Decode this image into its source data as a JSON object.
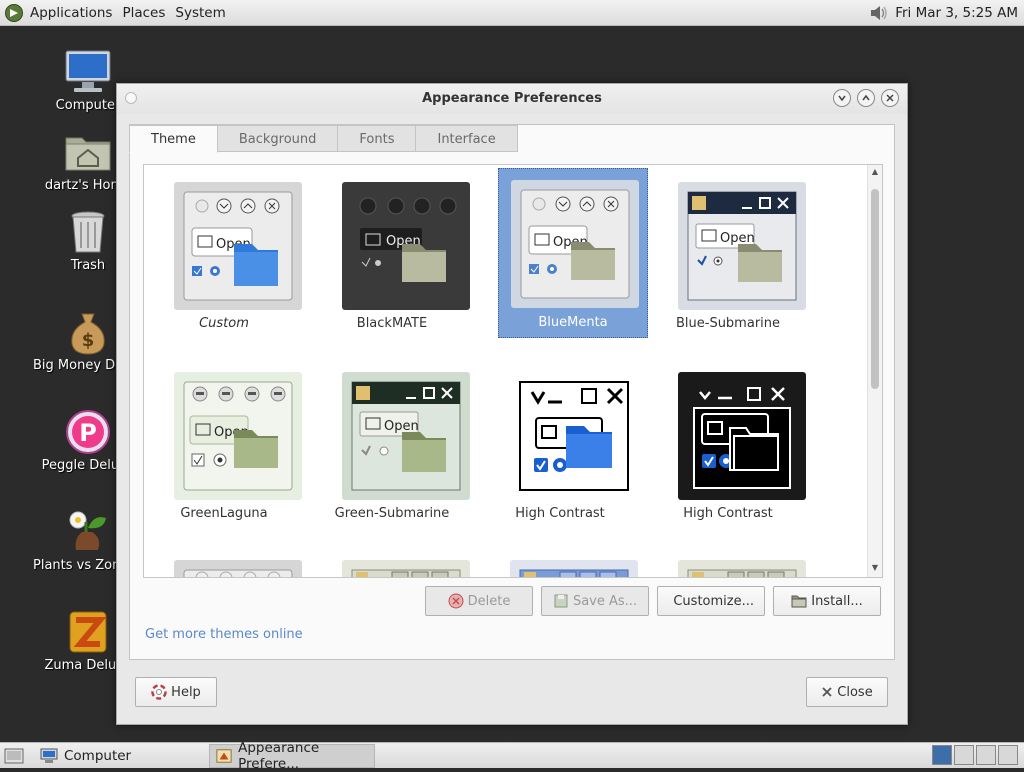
{
  "top_panel": {
    "menus": [
      "Applications",
      "Places",
      "System"
    ],
    "clock": "Fri Mar  3,  5:25 AM"
  },
  "desktop": {
    "icons": [
      {
        "label": "Computer",
        "icon": "computer-icon"
      },
      {
        "label": "dartz's Home",
        "icon": "home-folder-icon"
      },
      {
        "label": "Trash",
        "icon": "trash-icon"
      },
      {
        "label": "Big Money Deluxe",
        "icon": "money-bag-icon"
      },
      {
        "label": "Peggle Deluxe",
        "icon": "peggle-icon"
      },
      {
        "label": "Plants vs Zombies",
        "icon": "plants-icon"
      },
      {
        "label": "Zuma Deluxe",
        "icon": "zuma-icon"
      }
    ]
  },
  "window": {
    "title": "Appearance Preferences",
    "tabs": [
      "Theme",
      "Background",
      "Fonts",
      "Interface"
    ],
    "active_tab": "Theme",
    "themes": [
      {
        "name": "Custom",
        "style": "light"
      },
      {
        "name": "BlackMATE",
        "style": "dark"
      },
      {
        "name": "BlueMenta",
        "style": "light",
        "selected": true
      },
      {
        "name": "Blue-Submarine",
        "style": "sub"
      },
      {
        "name": "GreenLaguna",
        "style": "green"
      },
      {
        "name": "Green-Submarine",
        "style": "sub-green"
      },
      {
        "name": "High Contrast",
        "style": "hc"
      },
      {
        "name": "High Contrast",
        "style": "hc-inverse"
      }
    ],
    "thumb_open_label": "Open",
    "buttons": {
      "delete": "Delete",
      "save_as": "Save As...",
      "customize": "Customize...",
      "install": "Install..."
    },
    "more_link": "Get more themes online",
    "help": "Help",
    "close": "Close"
  },
  "bottom_panel": {
    "tasks": [
      "Computer",
      "Appearance Prefere..."
    ]
  },
  "colors": {
    "selection": "#7aa1d8",
    "link": "#5a88c9",
    "desktop": "#2b2b2b"
  }
}
